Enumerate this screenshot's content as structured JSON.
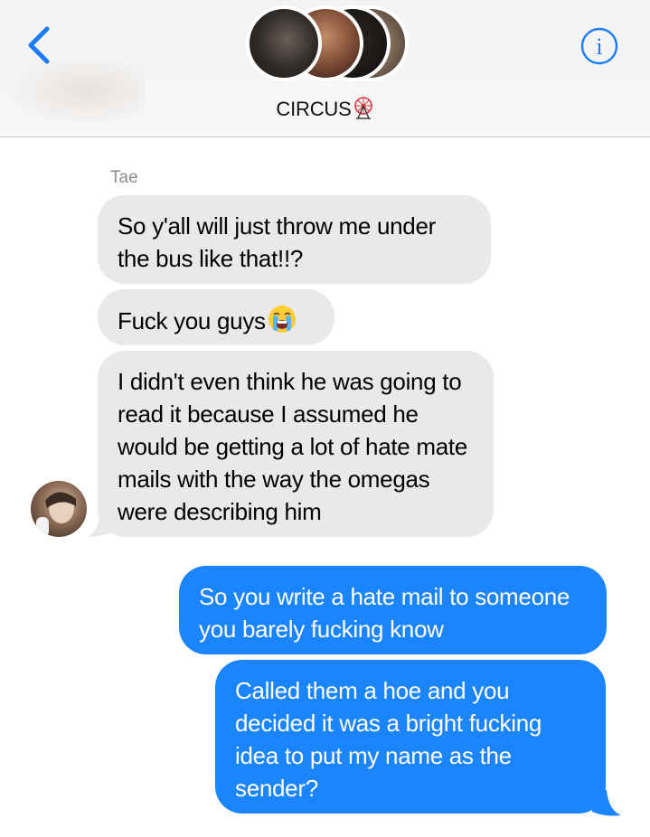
{
  "header": {
    "title": "CIRCUS",
    "title_emoji_icon": "ferris-wheel-icon",
    "back_icon": "chevron-left-icon",
    "info_icon": "info-icon",
    "accent_color": "#1b7cff"
  },
  "messages": [
    {
      "sender": "Tae",
      "direction": "incoming",
      "text": "So y'all will just throw me under the bus like that!!?"
    },
    {
      "direction": "incoming",
      "text": "Fuck you guys",
      "emoji_icon": "loudly-crying-face-icon"
    },
    {
      "direction": "incoming",
      "text": "I didn't even think he was going to read it because I assumed he would be getting a lot of hate mate mails with the way the omegas were describing him"
    },
    {
      "direction": "outgoing",
      "text": "So you write a hate mail to someone you barely fucking know"
    },
    {
      "direction": "outgoing",
      "text": "Called them a hoe and you decided it was a bright fucking idea to put my name as the sender?"
    }
  ],
  "colors": {
    "incoming_bubble": "#e9e9eb",
    "outgoing_bubble": "#1b84ff"
  }
}
